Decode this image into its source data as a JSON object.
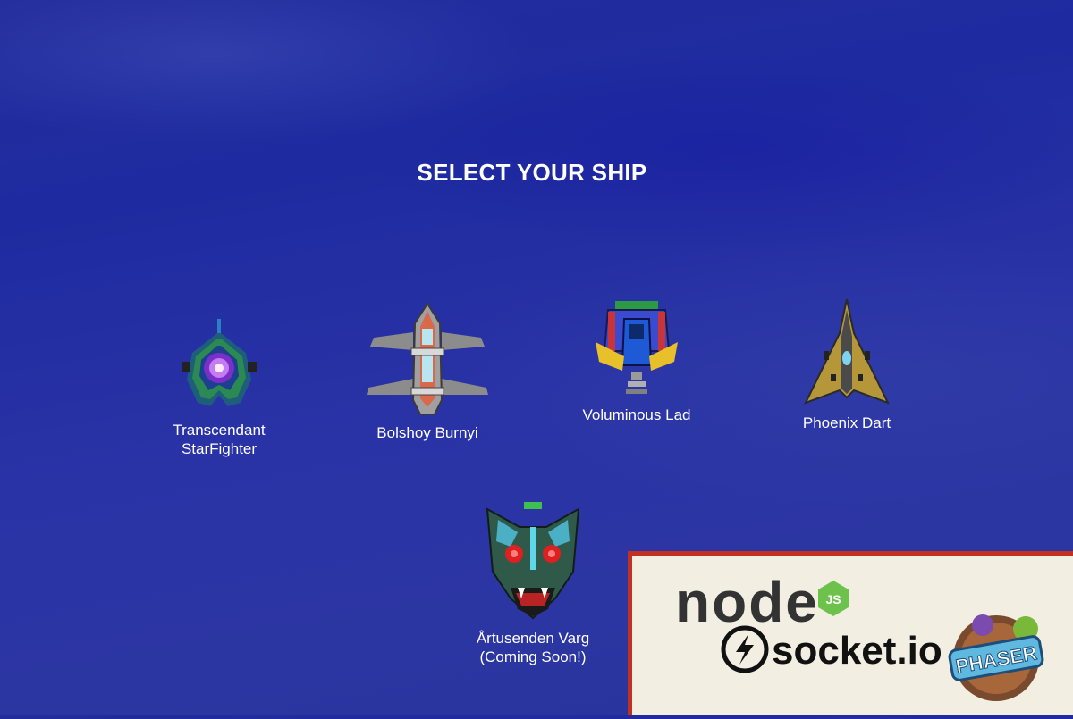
{
  "screen": {
    "title": "SELECT YOUR SHIP"
  },
  "ships": [
    {
      "name": "Transcendant",
      "name_line2": "StarFighter",
      "icon": "starfighter-ship-icon"
    },
    {
      "name": "Bolshoy Burnyi",
      "icon": "bolshoy-burnyi-ship-icon"
    },
    {
      "name": "Voluminous Lad",
      "icon": "voluminous-lad-ship-icon"
    },
    {
      "name": "Phoenix Dart",
      "icon": "phoenix-dart-ship-icon"
    },
    {
      "name": "Årtusenden Varg",
      "status": "(Coming Soon!)",
      "icon": "wolf-head-ship-icon"
    }
  ],
  "tech_logos": {
    "node": "node",
    "node_js": "JS",
    "socket": "socket.io",
    "phaser": "PHASER"
  },
  "colors": {
    "background": "#232d9c",
    "panel_background": "#f2efe2",
    "panel_border": "#c23021",
    "node_green": "#6cc24a"
  }
}
